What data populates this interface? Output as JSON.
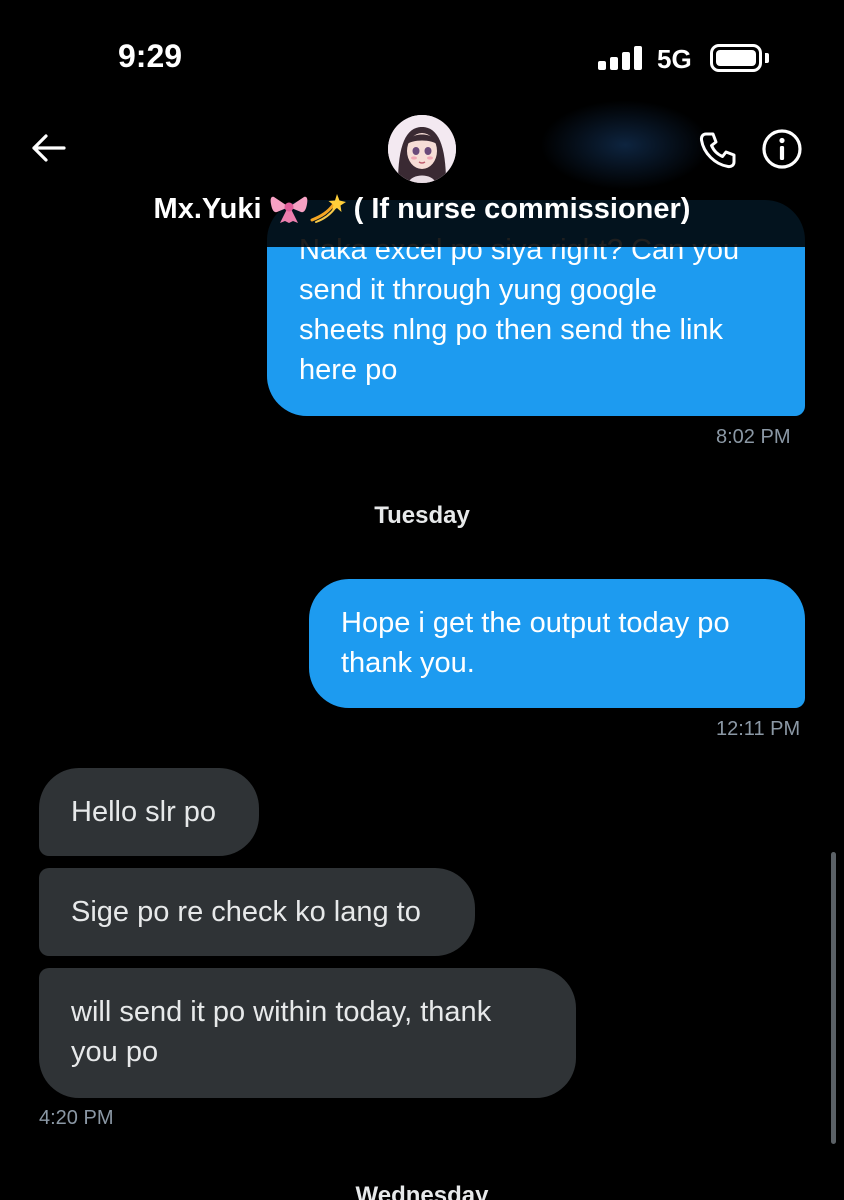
{
  "status_bar": {
    "time": "9:29",
    "network": "5G"
  },
  "header": {
    "contact_name": "Mx.Yuki",
    "contact_suffix": "( If nurse commissioner)",
    "emojis": [
      "ribbon-emoji",
      "dizzy-emoji"
    ]
  },
  "messages": [
    {
      "direction": "outgoing",
      "lines": [
        "Naka excel po siya right? Can you",
        "send it through yung google",
        "sheets nlng po then send the link",
        "here po"
      ]
    },
    {
      "direction": "outgoing",
      "lines": [
        "Hope i get the output today po",
        "thank you."
      ]
    },
    {
      "direction": "incoming",
      "lines": [
        "Hello slr po"
      ]
    },
    {
      "direction": "incoming",
      "lines": [
        "Sige po re check ko lang to"
      ]
    },
    {
      "direction": "incoming",
      "lines": [
        "will send it po within today, thank",
        "you po"
      ]
    }
  ],
  "timestamps": [
    "8:02 PM",
    "12:11 PM",
    "4:20 PM"
  ],
  "day_separators": [
    "Tuesday",
    "Wednesday"
  ],
  "colors": {
    "outgoing_bubble": "#1d9bf0",
    "incoming_bubble": "#2f3336",
    "background": "#000000",
    "timestamp": "#8b98a5"
  }
}
